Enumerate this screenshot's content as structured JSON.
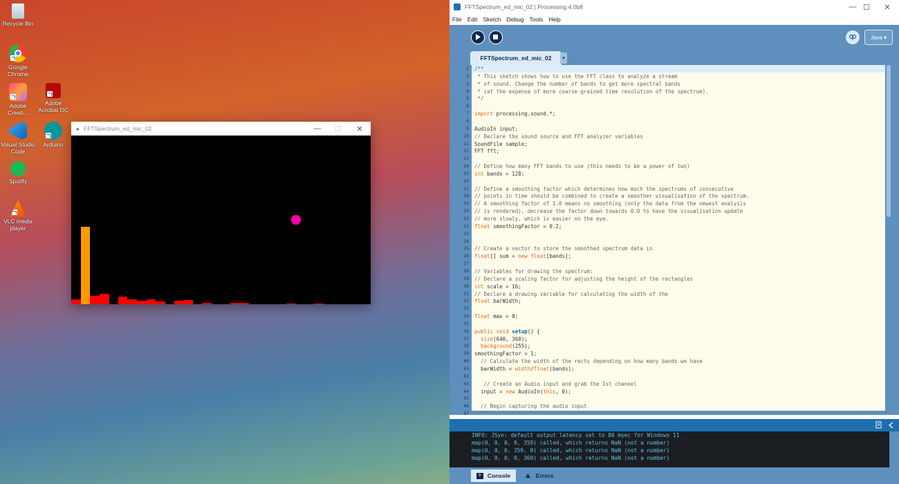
{
  "desktop": {
    "icons": [
      {
        "label": "Recycle Bin",
        "icon": "recycle-bin-icon"
      },
      {
        "label": "Google Chrome",
        "icon": "chrome-icon"
      },
      {
        "label": "Adobe Creati...",
        "icon": "adobe-creative-cloud-icon"
      },
      {
        "label": "Adobe Acrobat DC",
        "icon": "acrobat-icon"
      },
      {
        "label": "Visual Studio Code",
        "icon": "vscode-icon"
      },
      {
        "label": "Arduino",
        "icon": "arduino-icon"
      },
      {
        "label": "Spotify",
        "icon": "spotify-icon"
      },
      {
        "label": "VLC media player",
        "icon": "vlc-icon"
      }
    ]
  },
  "sketch_window": {
    "title": "FFTSpectrum_ed_mic_02",
    "background": "#000000",
    "bar_colors": {
      "highlight": "#ff9900",
      "normal": "#ff0000",
      "dot": "#ff00aa"
    }
  },
  "ide": {
    "title": "FFTSpectrum_ed_mic_02 | Processing 4.0b8",
    "menu": [
      "File",
      "Edit",
      "Sketch",
      "Debug",
      "Tools",
      "Help"
    ],
    "mode": "Java ▾",
    "tab": "FFTSpectrum_ed_mic_02",
    "tab_dropdown": "▾",
    "colors": {
      "toolbar": "#5e8fbd",
      "editor_bg": "#fffceb",
      "keyword": "#e2661a",
      "comment": "#666666",
      "accent": "#1e6fb0"
    },
    "code_lines": [
      "/**",
      " * This sketch shows how to use the FFT class to analyze a stream",
      " * of sound. Change the number of bands to get more spectral bands",
      " * (at the expense of more coarse-grained time resolution of the spectrum).",
      " */",
      "",
      "import processing.sound.*;",
      "",
      "AudioIn input;",
      "// Declare the sound source and FFT analyzer variables",
      "SoundFile sample;",
      "FFT fft;",
      "",
      "// Define how many FFT bands to use (this needs to be a power of two)",
      "int bands = 128;",
      "",
      "// Define a smoothing factor which determines how much the spectrums of consecutive",
      "// points in time should be combined to create a smoother visualisation of the spectrum.",
      "// A smoothing factor of 1.0 means no smoothing (only the data from the newest analysis",
      "// is rendered), decrease the factor down towards 0.0 to have the visualisation update",
      "// more slowly, which is easier on the eye.",
      "float smoothingFactor = 0.2;",
      "",
      "",
      "// Create a vector to store the smoothed spectrum data in",
      "float[] sum = new float[bands];",
      "",
      "// Variables for drawing the spectrum:",
      "// Declare a scaling factor for adjusting the height of the rectangles",
      "int scale = 16;",
      "// Declare a drawing variable for calculating the width of the",
      "float barWidth;",
      "",
      "float max = 0;",
      "",
      "public void setup() {",
      "  size(640, 360);",
      "  background(255);",
      "smoothingFactor = 1;",
      "  // Calculate the width of the rects depending on how many bands we have",
      "  barWidth = width/float(bands);",
      "",
      "   // Create an Audio input and grab the 1st channel",
      "  input = new AudioIn(this, 0);",
      "",
      "  // Begin capturing the audio input",
      ""
    ],
    "console": [
      "INFO: JSyn: default output latency set to 80 msec for Windows 11",
      "map(0, 0, 0, 0, 359) called, which returns NaN (not a number)",
      "map(0, 0, 0, 359, 0) called, which returns NaN (not a number)",
      "map(0, 0, 0, 0, 360) called, which returns NaN (not a number)"
    ],
    "bottom_tabs": {
      "console": "Console",
      "errors": "Errors"
    }
  }
}
